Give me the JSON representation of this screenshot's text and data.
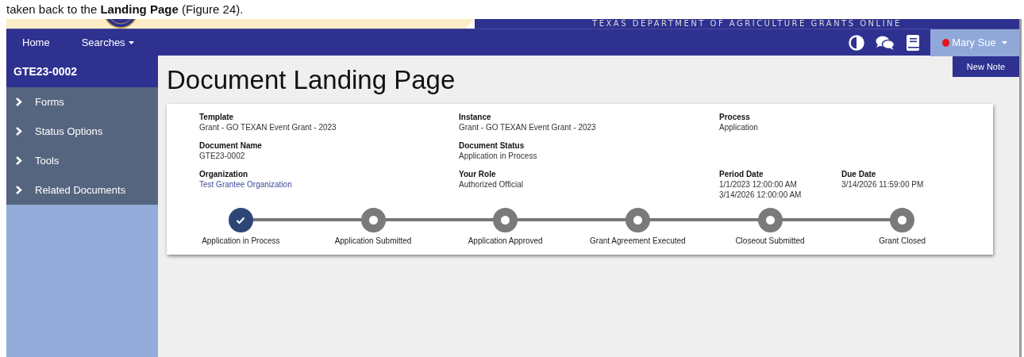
{
  "caption": "taken back to the **Landing Page** (Figure 24).",
  "banner": {
    "title": "TEXAS DEPARTMENT OF AGRICULTURE GRANTS ONLINE"
  },
  "navbar": {
    "links": [
      {
        "label": "Home",
        "dropdown": false
      },
      {
        "label": "Searches",
        "dropdown": true
      }
    ],
    "user": {
      "name": "Mary Sue",
      "color": "#e8141b"
    },
    "user_menu": [
      "New Note"
    ]
  },
  "sidebar": {
    "title": "GTE23-0002",
    "items": [
      "Forms",
      "Status Options",
      "Tools",
      "Related Documents"
    ]
  },
  "page_title": "Document Landing Page",
  "fields": [
    [
      {
        "label": "Template",
        "value": [
          "Grant - GO TEXAN Event Grant - 2023"
        ],
        "kind": "text"
      },
      {
        "label": "Instance",
        "value": [
          "Grant - GO TEXAN Event Grant - 2023"
        ],
        "kind": "text"
      },
      {
        "label": "Process",
        "value": [
          "Application"
        ],
        "kind": "text"
      }
    ],
    [
      {
        "label": "Document Name",
        "value": [
          "GTE23-0002"
        ],
        "kind": "text"
      },
      {
        "label": "Document Status",
        "value": [
          "Application in Process"
        ],
        "kind": "text"
      }
    ],
    [
      {
        "label": "Organization",
        "value": [
          "Test Grantee Organization"
        ],
        "kind": "link"
      },
      {
        "label": "Your Role",
        "value": [
          "Authorized Official"
        ],
        "kind": "text"
      },
      {
        "label": "Period Date",
        "value": [
          "1/1/2023 12:00:00 AM",
          "3/14/2026 12:00:00 AM"
        ],
        "kind": "text"
      },
      {
        "label": "Due Date",
        "value": [
          "3/14/2026 11:59:00 PM"
        ],
        "kind": "text"
      }
    ]
  ],
  "steps": [
    {
      "label": "Application in Process",
      "done": true
    },
    {
      "label": "Application Submitted",
      "done": false
    },
    {
      "label": "Application Approved",
      "done": false
    },
    {
      "label": "Grant Agreement Executed",
      "done": false
    },
    {
      "label": "Closeout Submitted",
      "done": false
    },
    {
      "label": "Grant Closed",
      "done": false
    }
  ]
}
